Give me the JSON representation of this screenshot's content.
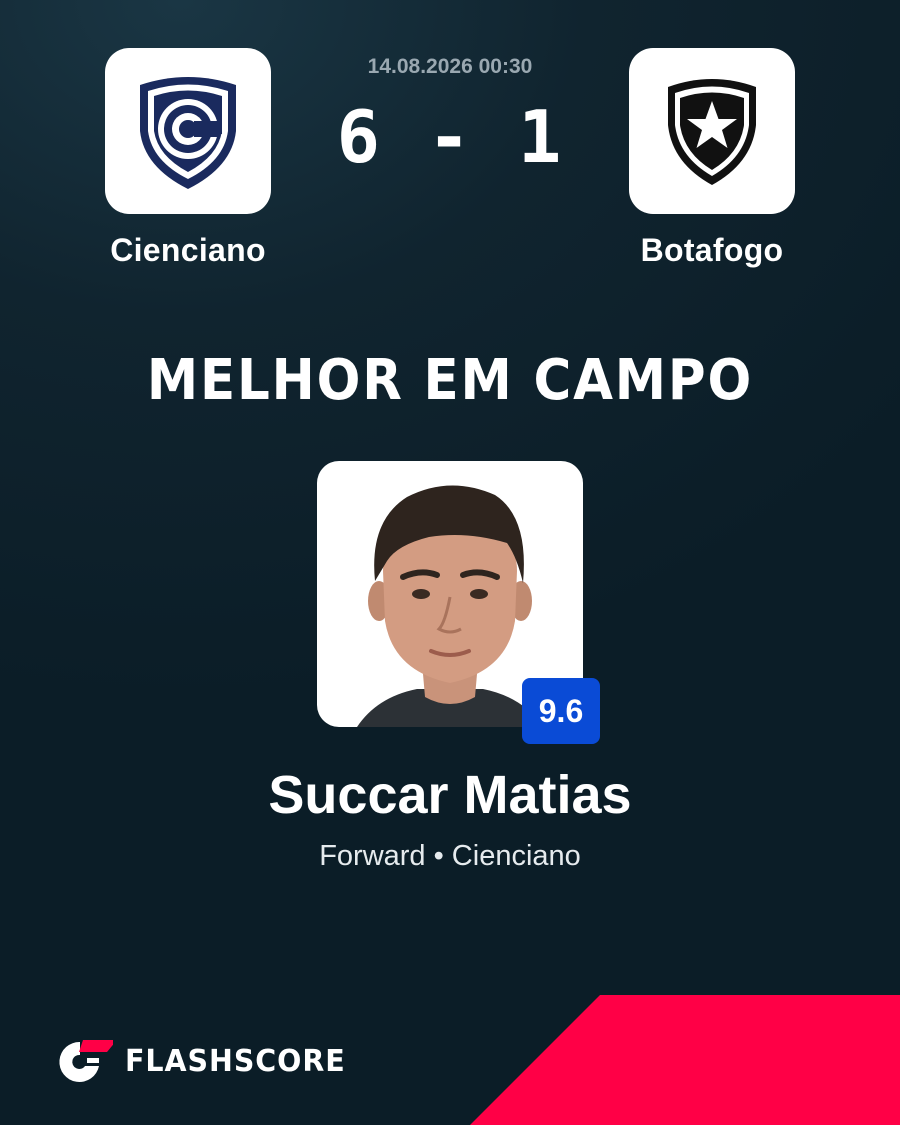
{
  "match": {
    "datetime": "14.08.2026 00:30",
    "score": "6 - 1",
    "home": {
      "name": "Cienciano",
      "logo_icon": "cienciano-crest-icon",
      "color": "#1a2a5e"
    },
    "away": {
      "name": "Botafogo",
      "logo_icon": "botafogo-star-crest-icon",
      "color": "#111111"
    }
  },
  "headline": "MELHOR EM CAMPO",
  "player": {
    "name": "Succar Matias",
    "meta": "Forward • Cienciano",
    "rating": "9.6",
    "rating_color": "#0a4bd6",
    "photo": "player-photo"
  },
  "brand": {
    "name": "FLASHSCORE",
    "logo_icon": "flashscore-logo-icon",
    "accent": "#ff0046"
  }
}
